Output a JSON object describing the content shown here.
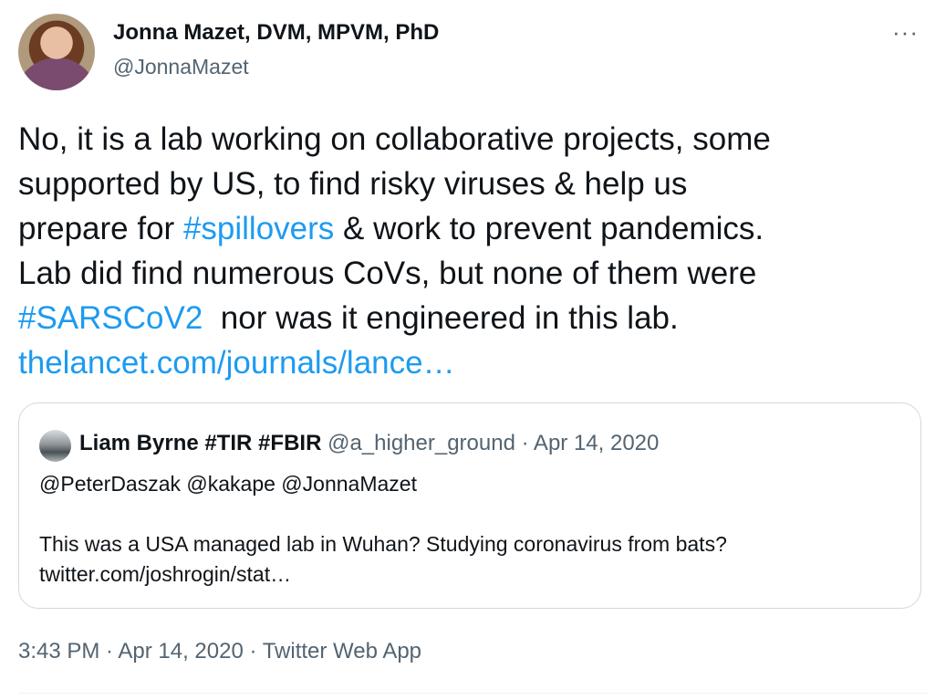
{
  "tweet": {
    "author_name": "Jonna Mazet, DVM, MPVM, PhD",
    "author_handle": "@JonnaMazet",
    "more_label": "···",
    "text": {
      "line1": "No, it is a lab working on collaborative projects, some",
      "line2": "supported by US, to find risky viruses & help us",
      "line3_pre": "prepare for ",
      "hashtag1": "#spillovers",
      "line3_post": " & work to prevent pandemics.",
      "line4": "Lab did find numerous CoVs, but none of them were",
      "hashtag2": "#SARSCoV2",
      "line5_post": "  nor was it engineered in this lab.",
      "link": "thelancet.com/journals/lance…"
    },
    "timestamp": "3:43 PM · Apr 14, 2020 · Twitter Web App"
  },
  "quote": {
    "author_name": "Liam Byrne #TIR #FBIR",
    "meta": " @a_higher_ground · Apr 14, 2020",
    "mentions": "@PeterDaszak @kakape @JonnaMazet",
    "body": "This was a USA managed lab in Wuhan? Studying coronavirus from bats?",
    "link": "twitter.com/joshrogin/stat…"
  },
  "colors": {
    "text": "#0f1419",
    "secondary": "#536471",
    "link": "#1d9bf0",
    "border": "#cfd9de"
  }
}
